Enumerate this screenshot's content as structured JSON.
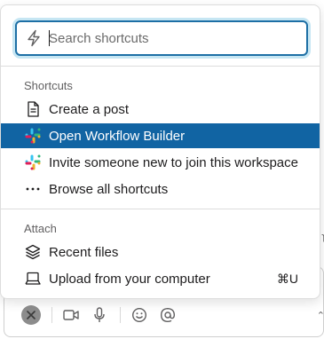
{
  "search": {
    "placeholder": "Search shortcuts"
  },
  "sections": {
    "shortcuts": {
      "title": "Shortcuts",
      "items": [
        {
          "label": "Create a post",
          "icon": "document-icon"
        },
        {
          "label": "Open Workflow Builder",
          "icon": "slack-logo-icon",
          "selected": true
        },
        {
          "label": "Invite someone new to join this workspace",
          "icon": "slack-logo-icon"
        },
        {
          "label": "Browse all shortcuts",
          "icon": "more-dots-icon"
        }
      ]
    },
    "attach": {
      "title": "Attach",
      "items": [
        {
          "label": "Recent files",
          "icon": "layers-icon"
        },
        {
          "label": "Upload from your computer",
          "icon": "laptop-icon",
          "shortcut": "⌘U"
        }
      ]
    }
  },
  "colors": {
    "accent": "#1164a3",
    "focus": "#1d6fa5"
  },
  "composer": {
    "toolbar": [
      "close-icon",
      "video-icon",
      "microphone-icon",
      "emoji-icon",
      "mention-icon"
    ]
  }
}
